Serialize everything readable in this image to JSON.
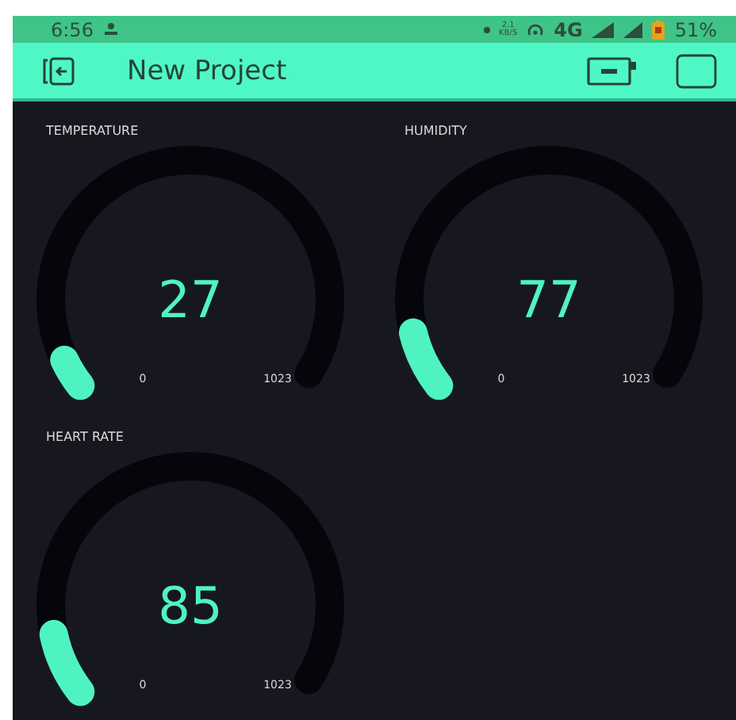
{
  "status_bar": {
    "time": "6:56",
    "speed": "2.1",
    "speed_unit": "KB/S",
    "network": "4G",
    "battery": "51%"
  },
  "app_bar": {
    "title": "New Project"
  },
  "gauges": [
    {
      "label": "TEMPERATURE",
      "value": "27",
      "min": "0",
      "max": "1023"
    },
    {
      "label": "HUMIDITY",
      "value": "77",
      "min": "0",
      "max": "1023"
    },
    {
      "label": "HEART RATE",
      "value": "85",
      "min": "0",
      "max": "1023"
    }
  ]
}
